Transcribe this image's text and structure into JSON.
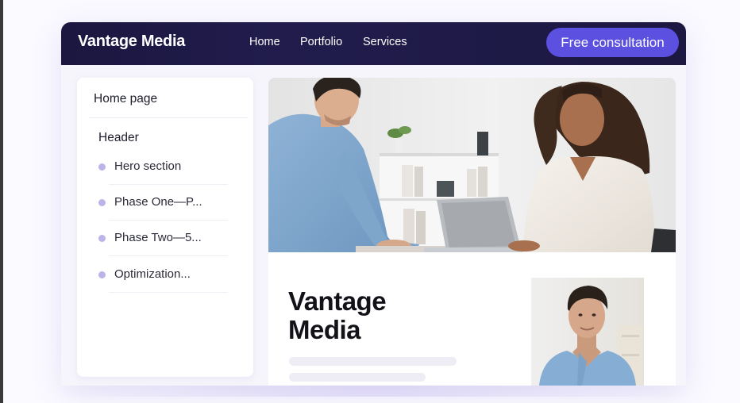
{
  "navbar": {
    "brand": "Vantage Media",
    "links": [
      "Home",
      "Portfolio",
      "Services"
    ],
    "cta": "Free consultation"
  },
  "sidebar": {
    "home": "Home page",
    "section": "Header",
    "items": [
      {
        "label": "Hero section"
      },
      {
        "label": "Phase One—P..."
      },
      {
        "label": "Phase Two—5..."
      },
      {
        "label": "Optimization..."
      }
    ]
  },
  "main": {
    "title_line1": "Vantage",
    "title_line2": "Media"
  },
  "colors": {
    "navbar_bg": "#1b1740",
    "accent": "#5b50e0",
    "sidebar_dot": "#bbb4e8"
  }
}
